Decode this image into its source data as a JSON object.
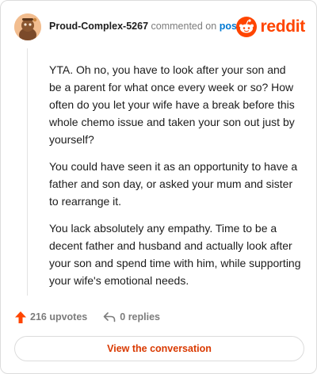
{
  "header": {
    "username": "Proud-Complex-5267",
    "action_text": "commented on",
    "post_link": "post",
    "brand": "reddit"
  },
  "comment": {
    "paragraphs": [
      "YTA. Oh no, you have to look after your son and be a parent for what once every week or so? How often do you let your wife have a break before this whole chemo issue and taken your son out just by yourself?",
      "You could have seen it as an opportunity to have a father and son day, or asked your mum and sister to rearrange it.",
      "You lack absolutely any empathy. Time to be a decent father and husband and actually look after your son and spend time with him, while supporting your wife's emotional needs."
    ]
  },
  "footer": {
    "upvotes": "216 upvotes",
    "replies": "0 replies",
    "upvote_icon": "upvote-arrow-icon",
    "reply_icon": "reply-arrow-icon"
  },
  "view_button": {
    "label": "View the conversation"
  },
  "colors": {
    "brand": "#ff4500",
    "link": "#0079d3",
    "button_text": "#d93900",
    "muted": "#7c7c7c"
  }
}
